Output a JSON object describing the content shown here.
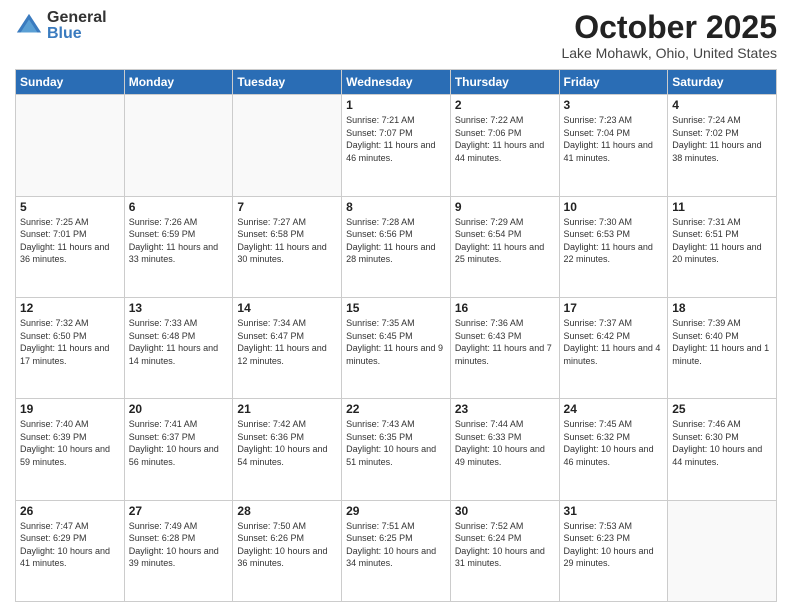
{
  "header": {
    "logo": {
      "general": "General",
      "blue": "Blue"
    },
    "title": "October 2025",
    "subtitle": "Lake Mohawk, Ohio, United States"
  },
  "days_of_week": [
    "Sunday",
    "Monday",
    "Tuesday",
    "Wednesday",
    "Thursday",
    "Friday",
    "Saturday"
  ],
  "weeks": [
    [
      {
        "day": "",
        "info": ""
      },
      {
        "day": "",
        "info": ""
      },
      {
        "day": "",
        "info": ""
      },
      {
        "day": "1",
        "info": "Sunrise: 7:21 AM\nSunset: 7:07 PM\nDaylight: 11 hours and 46 minutes."
      },
      {
        "day": "2",
        "info": "Sunrise: 7:22 AM\nSunset: 7:06 PM\nDaylight: 11 hours and 44 minutes."
      },
      {
        "day": "3",
        "info": "Sunrise: 7:23 AM\nSunset: 7:04 PM\nDaylight: 11 hours and 41 minutes."
      },
      {
        "day": "4",
        "info": "Sunrise: 7:24 AM\nSunset: 7:02 PM\nDaylight: 11 hours and 38 minutes."
      }
    ],
    [
      {
        "day": "5",
        "info": "Sunrise: 7:25 AM\nSunset: 7:01 PM\nDaylight: 11 hours and 36 minutes."
      },
      {
        "day": "6",
        "info": "Sunrise: 7:26 AM\nSunset: 6:59 PM\nDaylight: 11 hours and 33 minutes."
      },
      {
        "day": "7",
        "info": "Sunrise: 7:27 AM\nSunset: 6:58 PM\nDaylight: 11 hours and 30 minutes."
      },
      {
        "day": "8",
        "info": "Sunrise: 7:28 AM\nSunset: 6:56 PM\nDaylight: 11 hours and 28 minutes."
      },
      {
        "day": "9",
        "info": "Sunrise: 7:29 AM\nSunset: 6:54 PM\nDaylight: 11 hours and 25 minutes."
      },
      {
        "day": "10",
        "info": "Sunrise: 7:30 AM\nSunset: 6:53 PM\nDaylight: 11 hours and 22 minutes."
      },
      {
        "day": "11",
        "info": "Sunrise: 7:31 AM\nSunset: 6:51 PM\nDaylight: 11 hours and 20 minutes."
      }
    ],
    [
      {
        "day": "12",
        "info": "Sunrise: 7:32 AM\nSunset: 6:50 PM\nDaylight: 11 hours and 17 minutes."
      },
      {
        "day": "13",
        "info": "Sunrise: 7:33 AM\nSunset: 6:48 PM\nDaylight: 11 hours and 14 minutes."
      },
      {
        "day": "14",
        "info": "Sunrise: 7:34 AM\nSunset: 6:47 PM\nDaylight: 11 hours and 12 minutes."
      },
      {
        "day": "15",
        "info": "Sunrise: 7:35 AM\nSunset: 6:45 PM\nDaylight: 11 hours and 9 minutes."
      },
      {
        "day": "16",
        "info": "Sunrise: 7:36 AM\nSunset: 6:43 PM\nDaylight: 11 hours and 7 minutes."
      },
      {
        "day": "17",
        "info": "Sunrise: 7:37 AM\nSunset: 6:42 PM\nDaylight: 11 hours and 4 minutes."
      },
      {
        "day": "18",
        "info": "Sunrise: 7:39 AM\nSunset: 6:40 PM\nDaylight: 11 hours and 1 minute."
      }
    ],
    [
      {
        "day": "19",
        "info": "Sunrise: 7:40 AM\nSunset: 6:39 PM\nDaylight: 10 hours and 59 minutes."
      },
      {
        "day": "20",
        "info": "Sunrise: 7:41 AM\nSunset: 6:37 PM\nDaylight: 10 hours and 56 minutes."
      },
      {
        "day": "21",
        "info": "Sunrise: 7:42 AM\nSunset: 6:36 PM\nDaylight: 10 hours and 54 minutes."
      },
      {
        "day": "22",
        "info": "Sunrise: 7:43 AM\nSunset: 6:35 PM\nDaylight: 10 hours and 51 minutes."
      },
      {
        "day": "23",
        "info": "Sunrise: 7:44 AM\nSunset: 6:33 PM\nDaylight: 10 hours and 49 minutes."
      },
      {
        "day": "24",
        "info": "Sunrise: 7:45 AM\nSunset: 6:32 PM\nDaylight: 10 hours and 46 minutes."
      },
      {
        "day": "25",
        "info": "Sunrise: 7:46 AM\nSunset: 6:30 PM\nDaylight: 10 hours and 44 minutes."
      }
    ],
    [
      {
        "day": "26",
        "info": "Sunrise: 7:47 AM\nSunset: 6:29 PM\nDaylight: 10 hours and 41 minutes."
      },
      {
        "day": "27",
        "info": "Sunrise: 7:49 AM\nSunset: 6:28 PM\nDaylight: 10 hours and 39 minutes."
      },
      {
        "day": "28",
        "info": "Sunrise: 7:50 AM\nSunset: 6:26 PM\nDaylight: 10 hours and 36 minutes."
      },
      {
        "day": "29",
        "info": "Sunrise: 7:51 AM\nSunset: 6:25 PM\nDaylight: 10 hours and 34 minutes."
      },
      {
        "day": "30",
        "info": "Sunrise: 7:52 AM\nSunset: 6:24 PM\nDaylight: 10 hours and 31 minutes."
      },
      {
        "day": "31",
        "info": "Sunrise: 7:53 AM\nSunset: 6:23 PM\nDaylight: 10 hours and 29 minutes."
      },
      {
        "day": "",
        "info": ""
      }
    ]
  ]
}
